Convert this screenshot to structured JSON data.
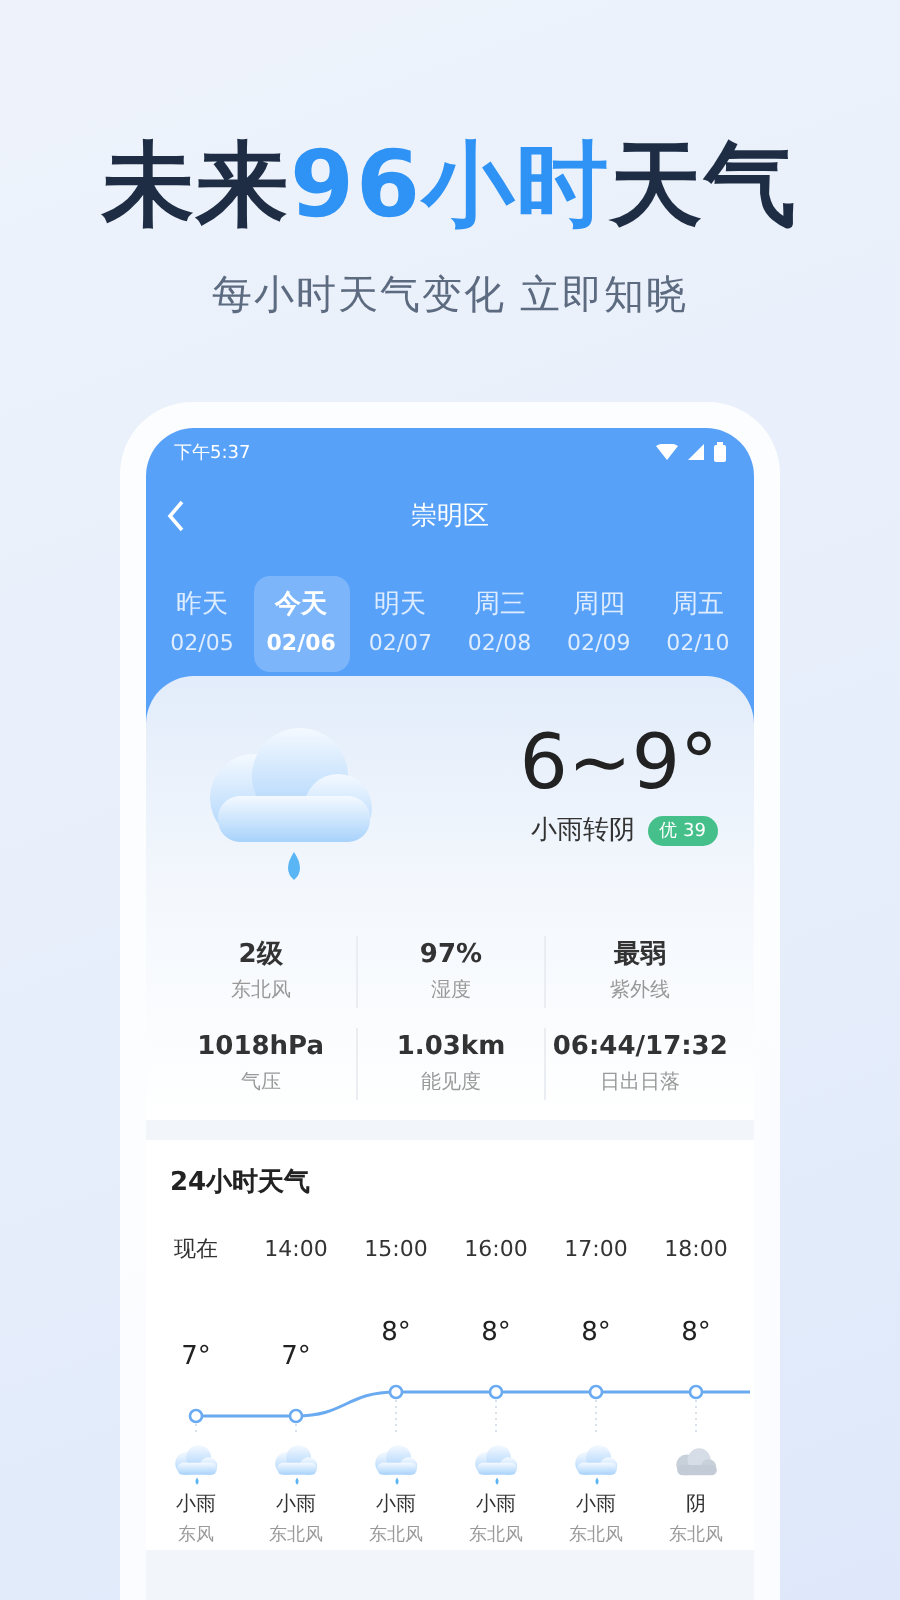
{
  "headline": [
    {
      "text": "未来",
      "highlight": false
    },
    {
      "text": "96小时",
      "highlight": true
    },
    {
      "text": "天气",
      "highlight": false
    }
  ],
  "subtitle": "每小时天气变化 立即知晓",
  "status_bar": {
    "time": "下午5:37"
  },
  "nav": {
    "title": "崇明区"
  },
  "days": [
    {
      "day": "昨天",
      "date": "02/05",
      "selected": false
    },
    {
      "day": "今天",
      "date": "02/06",
      "selected": true
    },
    {
      "day": "明天",
      "date": "02/07",
      "selected": false
    },
    {
      "day": "周三",
      "date": "02/08",
      "selected": false
    },
    {
      "day": "周四",
      "date": "02/09",
      "selected": false
    },
    {
      "day": "周五",
      "date": "02/10",
      "selected": false
    }
  ],
  "today": {
    "kind": "rain",
    "temperature": "6~9°",
    "condition": "小雨转阴",
    "aqi": "优 39"
  },
  "stats": [
    {
      "value": "2级",
      "label": "东北风"
    },
    {
      "value": "97%",
      "label": "湿度"
    },
    {
      "value": "最弱",
      "label": "紫外线"
    },
    {
      "value": "1018hPa",
      "label": "气压"
    },
    {
      "value": "1.03km",
      "label": "能见度"
    },
    {
      "value": "06:44/17:32",
      "label": "日出日落"
    }
  ],
  "hourly": {
    "title": "24小时天气",
    "hours": [
      {
        "time": "现在",
        "temp": "7°",
        "kind": "rain",
        "condition": "小雨",
        "wind": "东风"
      },
      {
        "time": "14:00",
        "temp": "7°",
        "kind": "rain",
        "condition": "小雨",
        "wind": "东北风"
      },
      {
        "time": "15:00",
        "temp": "8°",
        "kind": "rain",
        "condition": "小雨",
        "wind": "东北风"
      },
      {
        "time": "16:00",
        "temp": "8°",
        "kind": "rain",
        "condition": "小雨",
        "wind": "东北风"
      },
      {
        "time": "17:00",
        "temp": "8°",
        "kind": "rain",
        "condition": "小雨",
        "wind": "东北风"
      },
      {
        "time": "18:00",
        "temp": "8°",
        "kind": "cloudy",
        "condition": "阴",
        "wind": "东北风"
      }
    ]
  }
}
